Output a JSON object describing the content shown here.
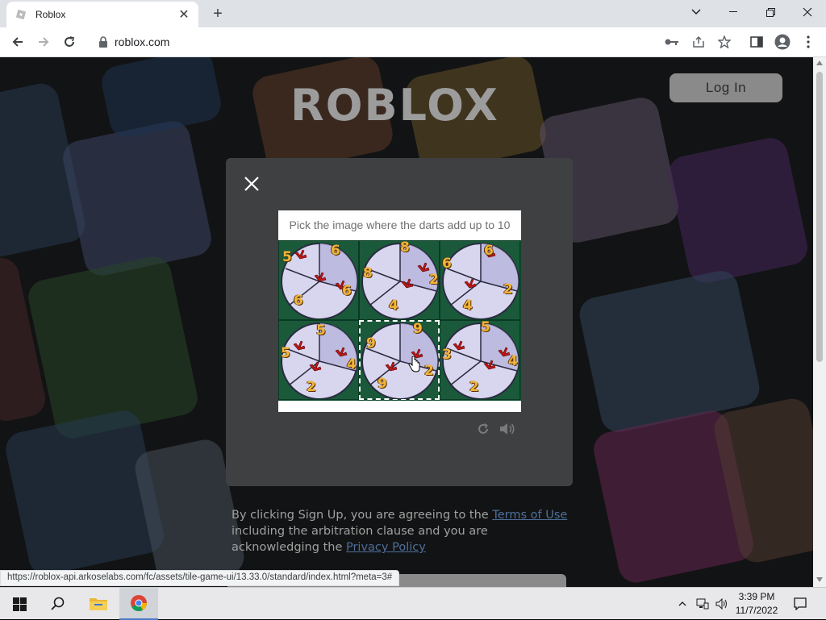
{
  "browser": {
    "tab_title": "Roblox",
    "new_tab": "+",
    "url": "roblox.com"
  },
  "page": {
    "logo_text": "ROBLOX",
    "login_label": "Log In",
    "captcha": {
      "prompt": "Pick the image where the darts add up to 10",
      "tiles": [
        {
          "numbers": [
            "5",
            "6",
            "6",
            "6"
          ]
        },
        {
          "numbers": [
            "8",
            "8",
            "2",
            "4"
          ]
        },
        {
          "numbers": [
            "6",
            "6",
            "2",
            "4"
          ]
        },
        {
          "numbers": [
            "5",
            "5",
            "4",
            "2"
          ]
        },
        {
          "numbers": [
            "9",
            "9",
            "2",
            "9"
          ]
        },
        {
          "numbers": [
            "5",
            "3",
            "4",
            "2"
          ]
        }
      ],
      "selected_index": 4
    },
    "terms": {
      "text_before": "By clicking Sign Up, you are agreeing to the ",
      "terms_link": "Terms of Use",
      "text_middle": " including the arbitration clause and you are acknowledging the ",
      "privacy_link": "Privacy Policy"
    },
    "status_url": "https://roblox-api.arkoselabs.com/fc/assets/tile-game-ui/13.33.0/standard/index.html?meta=3#"
  },
  "taskbar": {
    "time": "3:39 PM",
    "date": "11/7/2022"
  },
  "colors": {
    "accent_link": "#4e6f9a",
    "number_color": "#f0b43c"
  }
}
